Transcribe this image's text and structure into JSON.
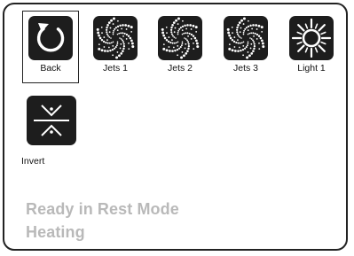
{
  "tiles": [
    {
      "label": "Back",
      "icon": "back-arrow-icon",
      "selected": true
    },
    {
      "label": "Jets 1",
      "icon": "jets-icon"
    },
    {
      "label": "Jets 2",
      "icon": "jets-icon"
    },
    {
      "label": "Jets 3",
      "icon": "jets-icon"
    },
    {
      "label": "Light 1",
      "icon": "light-sun-icon"
    },
    {
      "label": "Invert",
      "icon": "invert-icon"
    }
  ],
  "status": {
    "line1": "Ready in Rest Mode",
    "line2": "Heating"
  },
  "colors": {
    "tile_bg": "#1d1d1d",
    "icon_fg": "#ffffff",
    "status_text": "#b9b9b9",
    "border": "#222222"
  }
}
